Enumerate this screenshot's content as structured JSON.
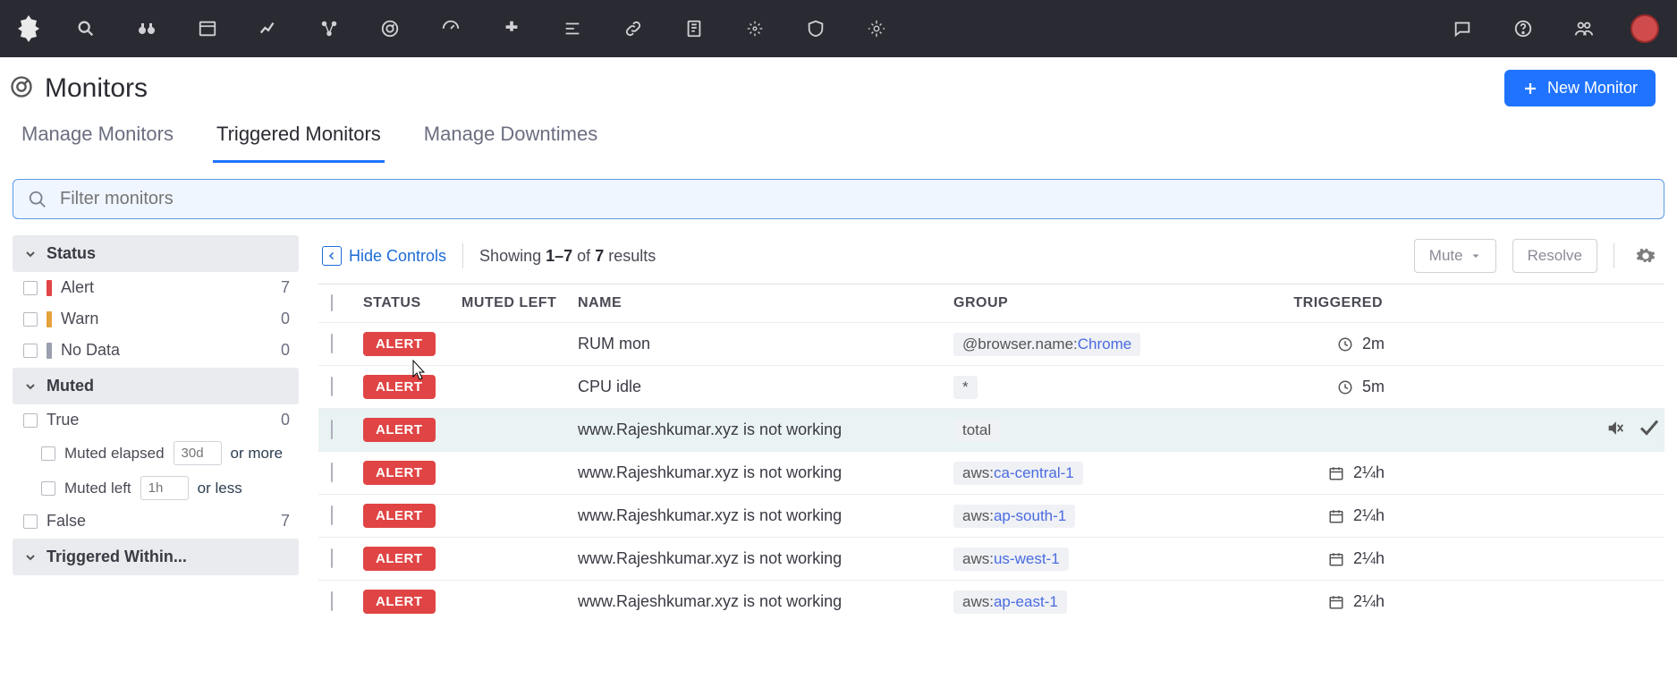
{
  "page": {
    "title": "Monitors"
  },
  "header": {
    "new_monitor_label": "New Monitor"
  },
  "tabs": [
    {
      "label": "Manage Monitors",
      "active": false
    },
    {
      "label": "Triggered Monitors",
      "active": true
    },
    {
      "label": "Manage Downtimes",
      "active": false
    }
  ],
  "search": {
    "placeholder": "Filter monitors"
  },
  "facets": {
    "status": {
      "title": "Status",
      "items": [
        {
          "label": "Alert",
          "count": "7",
          "color": "#e04444"
        },
        {
          "label": "Warn",
          "count": "0",
          "color": "#e6a23c"
        },
        {
          "label": "No Data",
          "count": "0",
          "color": "#9aa0af"
        }
      ]
    },
    "muted": {
      "title": "Muted",
      "true_label": "True",
      "true_count": "0",
      "elapsed_label": "Muted elapsed",
      "elapsed_placeholder": "30d",
      "elapsed_suffix": "or more",
      "left_label": "Muted left",
      "left_placeholder": "1h",
      "left_suffix": "or less",
      "false_label": "False",
      "false_count": "7"
    },
    "triggered_within": {
      "title": "Triggered Within..."
    }
  },
  "toolbar": {
    "hide_controls": "Hide Controls",
    "showing_prefix": "Showing",
    "showing_range": "1–7",
    "showing_of": "of",
    "showing_total": "7",
    "showing_suffix": "results",
    "mute_label": "Mute",
    "resolve_label": "Resolve"
  },
  "columns": {
    "status": "STATUS",
    "muted_left": "MUTED LEFT",
    "name": "NAME",
    "group": "GROUP",
    "triggered": "TRIGGERED"
  },
  "rows": [
    {
      "status": "ALERT",
      "name": "RUM mon",
      "group_key": "@browser.name:",
      "group_val": "Chrome",
      "triggered": "2m",
      "time_icon": "clock"
    },
    {
      "status": "ALERT",
      "name": "CPU idle",
      "group_key": "*",
      "group_val": "",
      "triggered": "5m",
      "time_icon": "clock"
    },
    {
      "status": "ALERT",
      "name": "www.Rajeshkumar.xyz is not working",
      "group_key": "total",
      "group_val": "",
      "triggered": "",
      "time_icon": "",
      "hovered": true
    },
    {
      "status": "ALERT",
      "name": "www.Rajeshkumar.xyz is not working",
      "group_key": "aws:",
      "group_val": "ca-central-1",
      "triggered": "2¼h",
      "time_icon": "calendar"
    },
    {
      "status": "ALERT",
      "name": "www.Rajeshkumar.xyz is not working",
      "group_key": "aws:",
      "group_val": "ap-south-1",
      "triggered": "2¼h",
      "time_icon": "calendar"
    },
    {
      "status": "ALERT",
      "name": "www.Rajeshkumar.xyz is not working",
      "group_key": "aws:",
      "group_val": "us-west-1",
      "triggered": "2¼h",
      "time_icon": "calendar"
    },
    {
      "status": "ALERT",
      "name": "www.Rajeshkumar.xyz is not working",
      "group_key": "aws:",
      "group_val": "ap-east-1",
      "triggered": "2¼h",
      "time_icon": "calendar"
    }
  ]
}
